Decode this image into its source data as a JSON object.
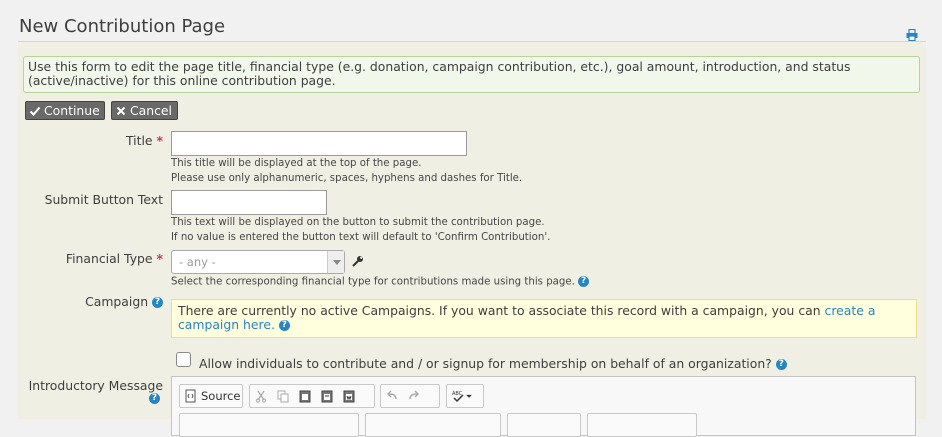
{
  "page": {
    "title": "New Contribution Page"
  },
  "help_text": "Use this form to edit the page title, financial type (e.g. donation, campaign contribution, etc.), goal amount, introduction, and status (active/inactive) for this online contribution page.",
  "buttons": {
    "continue": "Continue",
    "cancel": "Cancel"
  },
  "fields": {
    "title": {
      "label": "Title",
      "value": "",
      "desc1": "This title will be displayed at the top of the page.",
      "desc2": "Please use only alphanumeric, spaces, hyphens and dashes for Title."
    },
    "submit_button_text": {
      "label": "Submit Button Text",
      "value": "",
      "desc1": "This text will be displayed on the button to submit the contribution page.",
      "desc2": "If no value is entered the button text will default to 'Confirm Contribution'."
    },
    "financial_type": {
      "label": "Financial Type",
      "selected": "- any -",
      "desc": "Select the corresponding financial type for contributions made using this page."
    },
    "campaign": {
      "label": "Campaign",
      "message": "There are currently no active Campaigns. If you want to associate this record with a campaign, you can",
      "link": "create a campaign here."
    },
    "on_behalf": {
      "label": "Allow individuals to contribute and / or signup for membership on behalf of an organization?",
      "checked": false
    },
    "intro_message": {
      "label": "Introductory Message"
    }
  },
  "editor": {
    "source_label": "Source"
  },
  "colors": {
    "accent": "#2786c2",
    "required": "#cf3458",
    "help_border": "#b8d397"
  }
}
